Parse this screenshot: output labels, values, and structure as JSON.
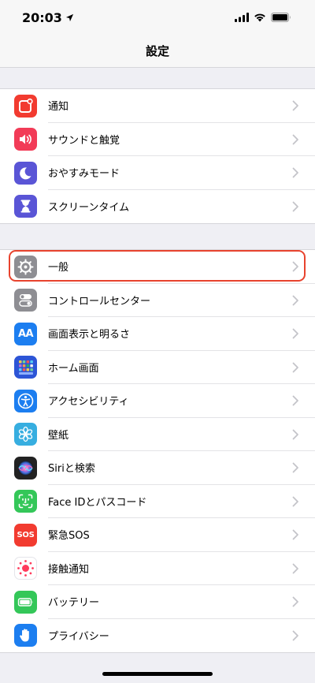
{
  "status_bar": {
    "time": "20:03"
  },
  "nav": {
    "title": "設定"
  },
  "groups": [
    {
      "items": [
        {
          "label": "通知",
          "icon": "notifications-icon",
          "color": "#f23b30"
        },
        {
          "label": "サウンドと触覚",
          "icon": "speaker-icon",
          "color": "#f23b57"
        },
        {
          "label": "おやすみモード",
          "icon": "moon-icon",
          "color": "#5a55d6"
        },
        {
          "label": "スクリーンタイム",
          "icon": "hourglass-icon",
          "color": "#5a55d6"
        }
      ]
    },
    {
      "items": [
        {
          "label": "一般",
          "icon": "gear-icon",
          "color": "#8e8e93",
          "highlighted": true
        },
        {
          "label": "コントロールセンター",
          "icon": "toggles-icon",
          "color": "#8e8e93"
        },
        {
          "label": "画面表示と明るさ",
          "icon": "text-size-icon",
          "color": "#1c7ef0",
          "icon_text": "AA"
        },
        {
          "label": "ホーム画面",
          "icon": "home-grid-icon",
          "color": "#2d55d6"
        },
        {
          "label": "アクセシビリティ",
          "icon": "accessibility-icon",
          "color": "#1c7ef0"
        },
        {
          "label": "壁紙",
          "icon": "wallpaper-flower-icon",
          "color": "#37aee0"
        },
        {
          "label": "Siriと検索",
          "icon": "siri-icon",
          "color": "#222222"
        },
        {
          "label": "Face IDとパスコード",
          "icon": "face-id-icon",
          "color": "#34c759"
        },
        {
          "label": "緊急SOS",
          "icon": "sos-icon",
          "color": "#f23b30",
          "icon_text": "SOS"
        },
        {
          "label": "接触通知",
          "icon": "exposure-notification-icon",
          "color": "#ffffff"
        },
        {
          "label": "バッテリー",
          "icon": "battery-icon",
          "color": "#34c759"
        },
        {
          "label": "プライバシー",
          "icon": "hand-icon",
          "color": "#1c7ef0"
        }
      ]
    }
  ]
}
